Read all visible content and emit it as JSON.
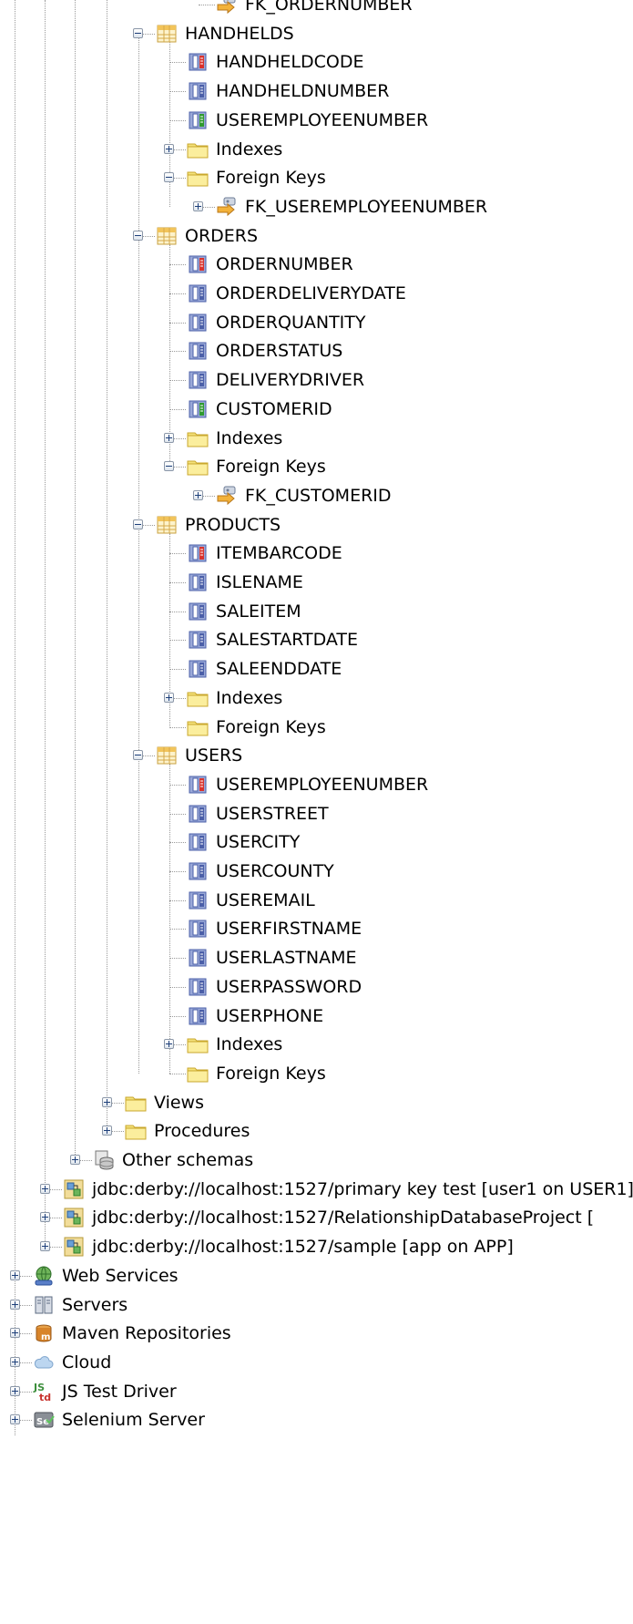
{
  "tree": {
    "nodes": [
      {
        "label": "FK_ORDERNUMBER",
        "icon": "fk-icon",
        "kind": "leaf"
      },
      {
        "label": "HANDHELDS",
        "icon": "table-icon",
        "kind": "minus"
      },
      {
        "label": "HANDHELDCODE",
        "icon": "pk-column-icon",
        "kind": "leaf"
      },
      {
        "label": "HANDHELDNUMBER",
        "icon": "column-icon",
        "kind": "leaf"
      },
      {
        "label": "USEREMPLOYEENUMBER",
        "icon": "fk-column-icon",
        "kind": "leaf"
      },
      {
        "label": "Indexes",
        "icon": "folder-icon",
        "kind": "plus"
      },
      {
        "label": "Foreign Keys",
        "icon": "folder-icon",
        "kind": "minus"
      },
      {
        "label": "FK_USEREMPLOYEENUMBER",
        "icon": "fk-icon",
        "kind": "plus"
      },
      {
        "label": "ORDERS",
        "icon": "table-icon",
        "kind": "minus"
      },
      {
        "label": "ORDERNUMBER",
        "icon": "pk-column-icon",
        "kind": "leaf"
      },
      {
        "label": "ORDERDELIVERYDATE",
        "icon": "column-icon",
        "kind": "leaf"
      },
      {
        "label": "ORDERQUANTITY",
        "icon": "column-icon",
        "kind": "leaf"
      },
      {
        "label": "ORDERSTATUS",
        "icon": "column-icon",
        "kind": "leaf"
      },
      {
        "label": "DELIVERYDRIVER",
        "icon": "column-icon",
        "kind": "leaf"
      },
      {
        "label": "CUSTOMERID",
        "icon": "fk-column-icon",
        "kind": "leaf"
      },
      {
        "label": "Indexes",
        "icon": "folder-icon",
        "kind": "plus"
      },
      {
        "label": "Foreign Keys",
        "icon": "folder-icon",
        "kind": "minus"
      },
      {
        "label": "FK_CUSTOMERID",
        "icon": "fk-icon",
        "kind": "plus"
      },
      {
        "label": "PRODUCTS",
        "icon": "table-icon",
        "kind": "minus"
      },
      {
        "label": "ITEMBARCODE",
        "icon": "pk-column-icon",
        "kind": "leaf"
      },
      {
        "label": "ISLENAME",
        "icon": "column-icon",
        "kind": "leaf"
      },
      {
        "label": "SALEITEM",
        "icon": "column-icon",
        "kind": "leaf"
      },
      {
        "label": "SALESTARTDATE",
        "icon": "column-icon",
        "kind": "leaf"
      },
      {
        "label": "SALEENDDATE",
        "icon": "column-icon",
        "kind": "leaf"
      },
      {
        "label": "Indexes",
        "icon": "folder-icon",
        "kind": "plus"
      },
      {
        "label": "Foreign Keys",
        "icon": "folder-icon",
        "kind": "leaf"
      },
      {
        "label": "USERS",
        "icon": "table-icon",
        "kind": "minus"
      },
      {
        "label": "USEREMPLOYEENUMBER",
        "icon": "pk-column-icon",
        "kind": "leaf"
      },
      {
        "label": "USERSTREET",
        "icon": "column-icon",
        "kind": "leaf"
      },
      {
        "label": "USERCITY",
        "icon": "column-icon",
        "kind": "leaf"
      },
      {
        "label": "USERCOUNTY",
        "icon": "column-icon",
        "kind": "leaf"
      },
      {
        "label": "USEREMAIL",
        "icon": "column-icon",
        "kind": "leaf"
      },
      {
        "label": "USERFIRSTNAME",
        "icon": "column-icon",
        "kind": "leaf"
      },
      {
        "label": "USERLASTNAME",
        "icon": "column-icon",
        "kind": "leaf"
      },
      {
        "label": "USERPASSWORD",
        "icon": "column-icon",
        "kind": "leaf"
      },
      {
        "label": "USERPHONE",
        "icon": "column-icon",
        "kind": "leaf"
      },
      {
        "label": "Indexes",
        "icon": "folder-icon",
        "kind": "plus"
      },
      {
        "label": "Foreign Keys",
        "icon": "folder-icon",
        "kind": "leaf"
      },
      {
        "label": "Views",
        "icon": "folder-icon",
        "kind": "plus"
      },
      {
        "label": "Procedures",
        "icon": "folder-icon",
        "kind": "plus"
      },
      {
        "label": "Other schemas",
        "icon": "schemas-icon",
        "kind": "plus"
      },
      {
        "label": "jdbc:derby://localhost:1527/primary key test [user1 on USER1]",
        "icon": "connection-icon",
        "kind": "plus"
      },
      {
        "label": "jdbc:derby://localhost:1527/RelationshipDatabaseProject [",
        "icon": "connection-icon",
        "kind": "plus"
      },
      {
        "label": "jdbc:derby://localhost:1527/sample [app on APP]",
        "icon": "connection-icon",
        "kind": "plus"
      },
      {
        "label": "Web Services",
        "icon": "web-services-icon",
        "kind": "plus"
      },
      {
        "label": "Servers",
        "icon": "servers-icon",
        "kind": "plus"
      },
      {
        "label": "Maven Repositories",
        "icon": "maven-icon",
        "kind": "plus"
      },
      {
        "label": "Cloud",
        "icon": "cloud-icon",
        "kind": "plus"
      },
      {
        "label": "JS Test Driver",
        "icon": "js-test-driver-icon",
        "kind": "plus"
      },
      {
        "label": "Selenium Server",
        "icon": "selenium-icon",
        "kind": "plus"
      }
    ]
  }
}
